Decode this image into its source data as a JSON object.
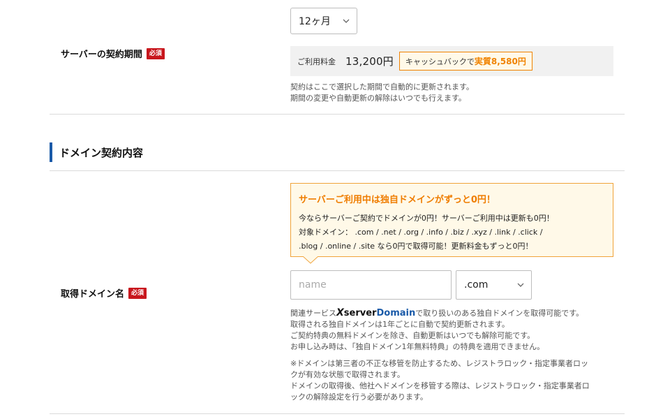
{
  "contract": {
    "label": "サーバーの契約期間",
    "required": "必須",
    "period_value": "12ヶ月",
    "fee_label": "ご利用料金",
    "fee_amount": "13,200円",
    "cashback_prefix": "キャッシュバックで",
    "cashback_amount": "実質8,580円",
    "notes": [
      "契約はここで選択した期間で自動的に更新されます。",
      "期間の変更や自動更新の解除はいつでも行えます。"
    ]
  },
  "domain_section": {
    "heading": "ドメイン契約内容"
  },
  "domain": {
    "label": "取得ドメイン名",
    "required": "必須",
    "promo": {
      "title": "サーバーご利用中は独自ドメインがずっと0円！",
      "lines": [
        "今ならサーバーご契約でドメインが0円！サーバーご利用中は更新も0円！",
        "対象ドメイン：  .com / .net / .org / .info / .biz / .xyz / .link / .click /",
        ".blog / .online / .site なら0円で取得可能！更新料金もずっと0円！"
      ]
    },
    "input_placeholder": "name",
    "input_value": "",
    "tld_value": ".com",
    "service_prefix": "関連サービス",
    "service_brand_x": "X",
    "service_brand_server": "server",
    "service_brand_domain": "Domain",
    "service_suffix": "で取り扱いのある独自ドメインを取得可能です。",
    "notes": [
      "取得される独自ドメインは1年ごとに自動で契約更新されます。",
      "ご契約特典の無料ドメインを除き、自動更新はいつでも解除可能です。",
      "お申し込み時は、「独自ドメイン1年無料特典」の特典を適用できません。"
    ],
    "warnings": [
      "※ドメインは第三者の不正な移管を防止するため、レジストラロック・指定事業者ロッ",
      "クが有効な状態で取得されます。",
      "ドメインの取得後、他社へドメインを移管する際は、レジストラロック・指定事業者ロ",
      "ックの解除設定を行う必要があります。"
    ]
  },
  "colors": {
    "accent_orange": "#ef7d00",
    "required_red": "#c8161d",
    "brand_blue": "#1a5aa8"
  },
  "icons": {
    "chevron": "chevron-down-icon"
  }
}
